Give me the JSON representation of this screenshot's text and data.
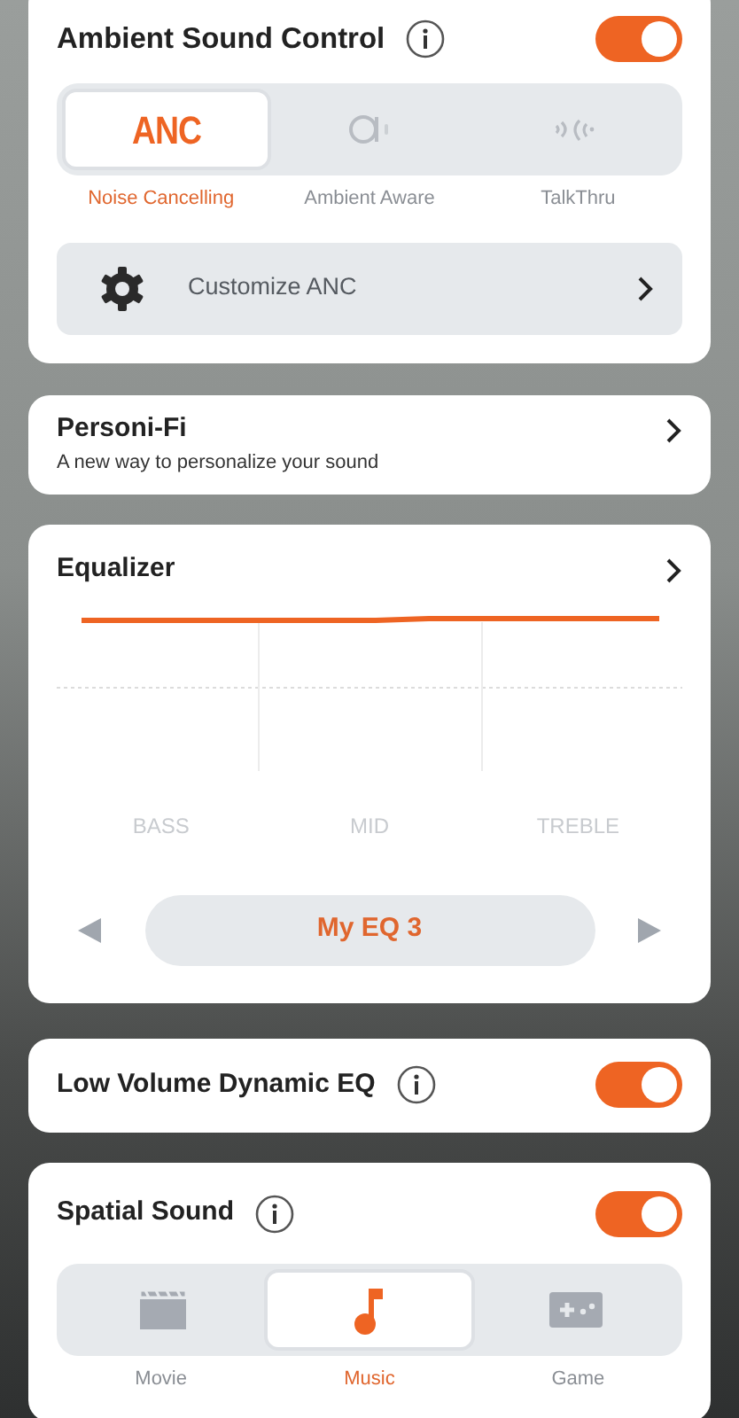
{
  "ambient_sound_control": {
    "title": "Ambient Sound Control",
    "on": true,
    "modes": [
      {
        "kind": "anc",
        "icon_text": "ANC",
        "label": "Noise Cancelling",
        "selected": true
      },
      {
        "kind": "aware",
        "label": "Ambient Aware",
        "selected": false
      },
      {
        "kind": "talkthru",
        "label": "TalkThru",
        "selected": false
      }
    ],
    "customize": {
      "label": "Customize ANC"
    }
  },
  "personi_fi": {
    "title": "Personi-Fi",
    "subtitle": "A new way to personalize your sound"
  },
  "equalizer": {
    "title": "Equalizer",
    "bands": [
      "BASS",
      "MID",
      "TREBLE"
    ],
    "preset": "My EQ 3"
  },
  "low_volume_dynamic_eq": {
    "title": "Low Volume Dynamic EQ",
    "on": true
  },
  "spatial_sound": {
    "title": "Spatial Sound",
    "on": true,
    "modes": [
      {
        "kind": "movie",
        "label": "Movie",
        "selected": false
      },
      {
        "kind": "music",
        "label": "Music",
        "selected": true
      },
      {
        "kind": "game",
        "label": "Game",
        "selected": false
      }
    ]
  }
}
